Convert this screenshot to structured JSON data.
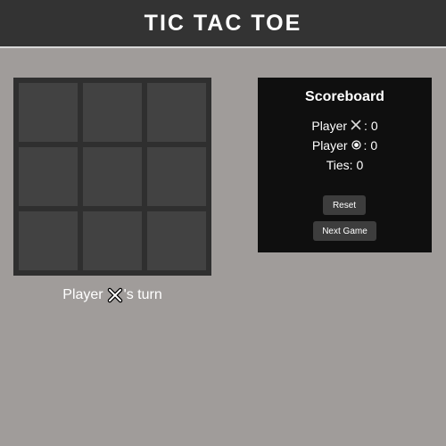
{
  "header": {
    "title": "TIC TAC TOE"
  },
  "board": {
    "cells": [
      "",
      "",
      "",
      "",
      "",
      "",
      "",
      "",
      ""
    ]
  },
  "turn": {
    "prefix": "Player",
    "suffix": "'s turn",
    "player_icon": "x-icon"
  },
  "scoreboard": {
    "title": "Scoreboard",
    "player_x": {
      "label": "Player",
      "icon": "x-icon",
      "value": ": 0"
    },
    "player_o": {
      "label": "Player",
      "icon": "o-icon",
      "value": ": 0"
    },
    "ties": {
      "label": "Ties: 0"
    },
    "reset_label": "Reset",
    "next_game_label": "Next Game"
  },
  "colors": {
    "background": "#a09c9a",
    "header": "#333333",
    "board": "#2f2f2f",
    "cell": "#424242",
    "scoreboard": "#0f0f0f",
    "button": "#3d3d3d"
  }
}
